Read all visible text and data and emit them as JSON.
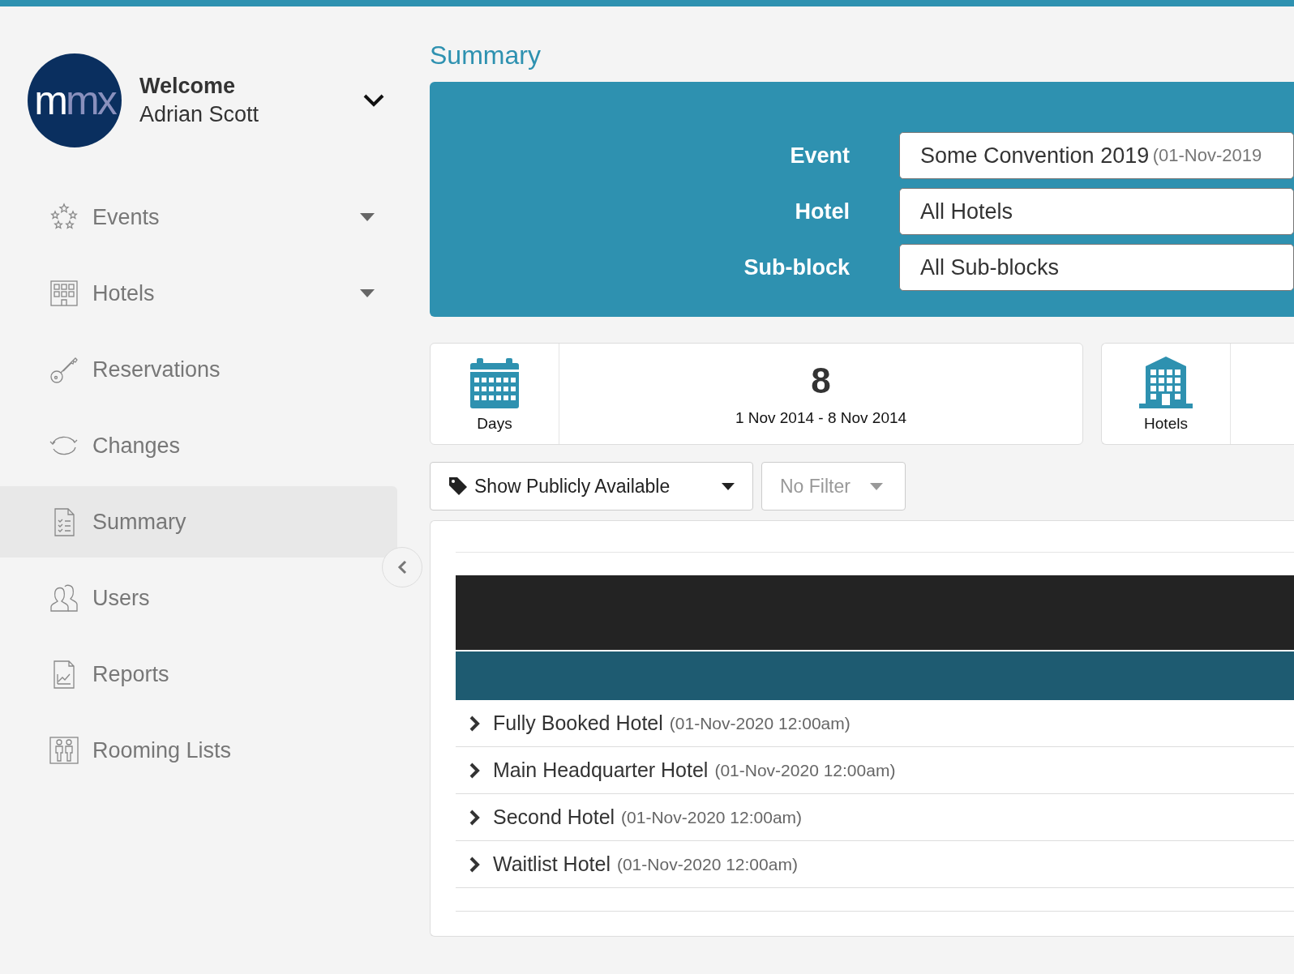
{
  "user": {
    "greeting": "Welcome",
    "name": "Adrian Scott",
    "logo_parts": [
      "m",
      "mx"
    ]
  },
  "sidebar": {
    "items": [
      {
        "label": "Events",
        "kind": "stars",
        "has_dropdown": true,
        "selected": false
      },
      {
        "label": "Hotels",
        "kind": "building",
        "has_dropdown": true,
        "selected": false
      },
      {
        "label": "Reservations",
        "kind": "key",
        "has_dropdown": false,
        "selected": false
      },
      {
        "label": "Changes",
        "kind": "refresh",
        "has_dropdown": false,
        "selected": false
      },
      {
        "label": "Summary",
        "kind": "checklist",
        "has_dropdown": false,
        "selected": true
      },
      {
        "label": "Users",
        "kind": "users",
        "has_dropdown": false,
        "selected": false
      },
      {
        "label": "Reports",
        "kind": "chart",
        "has_dropdown": false,
        "selected": false
      },
      {
        "label": "Rooming Lists",
        "kind": "people",
        "has_dropdown": false,
        "selected": false
      }
    ]
  },
  "page_title": "Summary",
  "filters": [
    {
      "label": "Event",
      "value": "Some Convention 2019",
      "detail": "(01-Nov-2019"
    },
    {
      "label": "Hotel",
      "value": "All Hotels"
    },
    {
      "label": "Sub-block",
      "value": "All Sub-blocks"
    }
  ],
  "stats": [
    {
      "kind": "calendar",
      "label": "Days",
      "value": "8",
      "detail": "1 Nov 2014 - 8 Nov 2014"
    },
    {
      "kind": "building",
      "label": "Hotels"
    }
  ],
  "toolbar": {
    "availability": "Show Publicly Available",
    "filter": "No Filter"
  },
  "hotels": [
    {
      "name": "Fully Booked Hotel",
      "date": "(01-Nov-2020 12:00am)"
    },
    {
      "name": "Main Headquarter Hotel",
      "date": "(01-Nov-2020 12:00am)"
    },
    {
      "name": "Second Hotel",
      "date": "(01-Nov-2020 12:00am)"
    },
    {
      "name": "Waitlist Hotel",
      "date": "(01-Nov-2020 12:00am)"
    }
  ]
}
